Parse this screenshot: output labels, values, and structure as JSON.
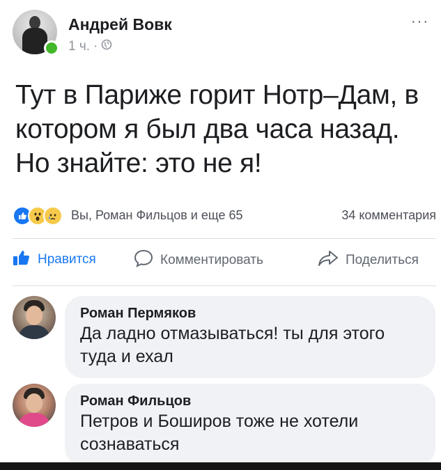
{
  "post": {
    "author": "Андрей Вовк",
    "time": "1 ч.",
    "separator": "·",
    "privacy_icon": "globe-icon",
    "more_icon": "ellipsis-icon",
    "more_label": "···",
    "text": "Тут в Париже горит Нотр–Дам, в котором я был два часа назад. Но знайте: это не я!"
  },
  "reactions": {
    "icons": [
      "like-icon",
      "wow-icon",
      "sad-icon"
    ],
    "summary": "Вы, Роман Фильцов и еще 65",
    "comments_count": "34 комментария"
  },
  "actions": {
    "like": "Нравится",
    "comment": "Комментировать",
    "share": "Поделиться"
  },
  "comments": [
    {
      "name": "Роман Пермяков",
      "text": "Да ладно отмазываться! ты для этого туда и ехал"
    },
    {
      "name": "Роман Фильцов",
      "text": "Петров и Боширов тоже не хотели сознаваться"
    }
  ],
  "colors": {
    "accent": "#1877f2",
    "online": "#42b72a",
    "muted": "#90949c",
    "bubble": "#f0f2f5"
  }
}
